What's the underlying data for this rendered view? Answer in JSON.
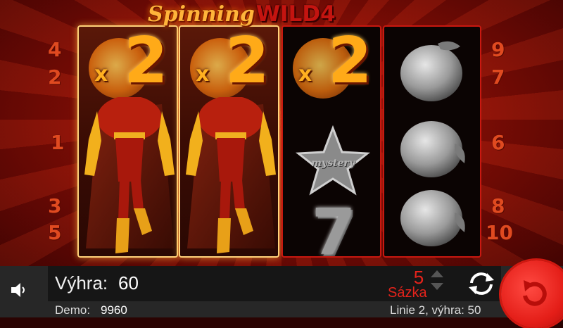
{
  "game": {
    "logo_part1": "Spinning",
    "logo_part2": "WILD4"
  },
  "paylines": {
    "left": [
      "4",
      "2",
      "1",
      "3",
      "5"
    ],
    "right": [
      "9",
      "7",
      "6",
      "8",
      "10"
    ]
  },
  "reels": [
    {
      "state": "wild",
      "multiplier_prefix": "x",
      "multiplier": "2",
      "symbol": "hero-wild"
    },
    {
      "state": "wild",
      "multiplier_prefix": "x",
      "multiplier": "2",
      "symbol": "hero-wild"
    },
    {
      "state": "dimmed",
      "multiplier_prefix": "x",
      "multiplier": "2",
      "symbols": [
        "star",
        "seven"
      ],
      "star_text": "mystery"
    },
    {
      "state": "dimmed",
      "symbols": [
        "orange",
        "orange",
        "orange"
      ]
    }
  ],
  "bottom_bar": {
    "win_label": "Výhra:",
    "win_value": "60",
    "balance_label": "Demo:",
    "balance_value": "9960",
    "bet_value": "5",
    "bet_label": "Sázka",
    "line_win_text": "Linie 2, výhra: 50",
    "sound_icon": "speaker-icon",
    "autoplay_icon": "autoplay-arrows-icon",
    "spin_icon": "spin-arrow-icon"
  },
  "colors": {
    "accent_red": "#e4231b",
    "bar_bg": "#272727",
    "panel_bg": "#161616",
    "gold": "#ffaa18"
  }
}
